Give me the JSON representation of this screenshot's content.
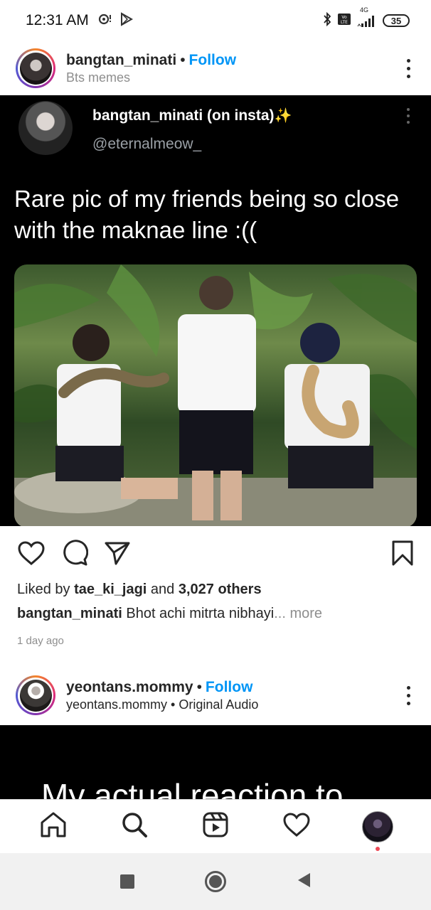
{
  "status_bar": {
    "time": "12:31 AM",
    "network": "4G",
    "battery": "35"
  },
  "post1": {
    "username": "bangtan_minati",
    "separator": "•",
    "follow_label": "Follow",
    "subtitle": "Bts memes",
    "tweet": {
      "display_name": "bangtan_minati (on insta)",
      "sparkle": "✨",
      "handle": "@eternalmeow_",
      "text": "Rare pic of my friends being so close with the maknae line :(("
    },
    "likes": {
      "prefix": "Liked by ",
      "liker": "tae_ki_jagi",
      "middle": " and ",
      "others": "3,027 others"
    },
    "caption": {
      "username": "bangtan_minati",
      "text": " Bhot achi mitrta nibhayi",
      "more": "... more"
    },
    "time_ago": "1 day ago"
  },
  "post2": {
    "username": "yeontans.mommy",
    "separator": "•",
    "follow_label": "Follow",
    "subtitle": "yeontans.mommy • Original Audio",
    "media_text": "My actual reaction to"
  },
  "colors": {
    "link_blue": "#0095f6",
    "text_dark": "#262626",
    "text_muted": "#8e8e8e",
    "notif_red": "#ed4956"
  },
  "icons": {
    "nav": [
      "home-icon",
      "search-icon",
      "reels-icon",
      "activity-heart-icon",
      "profile-avatar"
    ],
    "actions": [
      "like-heart-icon",
      "comment-icon",
      "share-icon",
      "save-bookmark-icon"
    ]
  }
}
